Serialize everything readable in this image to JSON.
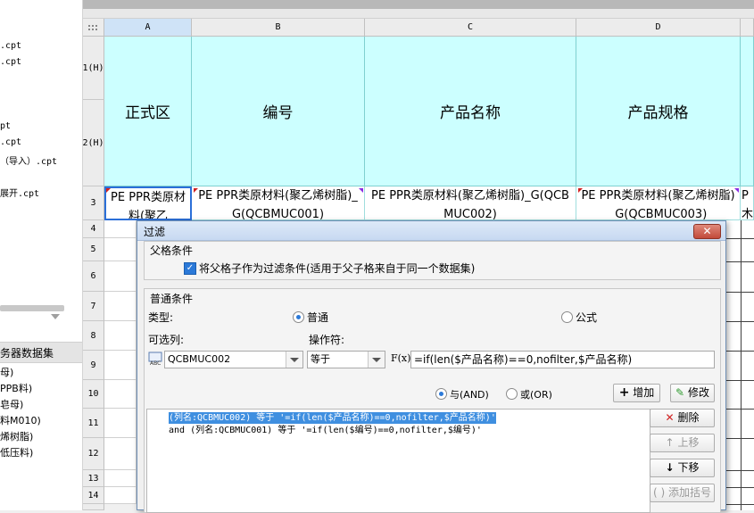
{
  "left_panel": {
    "files": [
      ".cpt",
      ".cpt",
      "pt",
      ".cpt",
      "（导入）.cpt",
      "展开.cpt"
    ],
    "section_title": "务器数据集",
    "datasets": [
      "母)",
      "PPB料)",
      "皂母)",
      "料M010)",
      "烯树脂)",
      "低压料)"
    ]
  },
  "sheet": {
    "columns": [
      "A",
      "B",
      "C",
      "D"
    ],
    "rows": [
      "1(H)",
      "2(H)",
      "3",
      "4",
      "5",
      "6",
      "7",
      "8",
      "9",
      "10",
      "11",
      "12",
      "13",
      "14"
    ],
    "header_cells": [
      "正式区",
      "编号",
      "产品名称",
      "产品规格"
    ],
    "row3_cells": [
      "PE  PPR类原材料(聚乙",
      "PE  PPR类原材料(聚乙烯树脂)_G(QCBMUC001)",
      "PE  PPR类原材料(聚乙烯树脂)_G(QCBMUC002)",
      "PE  PPR类原材料(聚乙烯树脂)_G(QCBMUC003)",
      "P 木"
    ]
  },
  "dialog": {
    "title": "过滤",
    "close_label": "✕",
    "parent_group": {
      "title": "父格条件",
      "checkbox_label": "将父格子作为过滤条件(适用于父子格来自于同一个数据集)",
      "checked": true
    },
    "normal_group": {
      "title": "普通条件",
      "type_label": "类型:",
      "type_options": [
        "普通",
        "公式"
      ],
      "type_selected": "普通",
      "column_label": "可选列:",
      "column_value": "QCBMUC002",
      "operator_label": "操作符:",
      "operator_value": "等于",
      "fx_label": "F(x)",
      "formula_value": "=if(len($产品名称)==0,nofilter,$产品名称)"
    },
    "logic": {
      "and_label": "与(AND)",
      "or_label": "或(OR)",
      "selected": "与(AND)"
    },
    "buttons": {
      "add": "增加",
      "modify": "修改",
      "delete": "删除",
      "up": "上移",
      "down": "下移",
      "add_bracket": "添加括号"
    },
    "conditions": [
      "(列名:QCBMUC002) 等于 '=if(len($产品名称)==0,nofilter,$产品名称)'",
      "and (列名:QCBMUC001) 等于 '=if(len($编号)==0,nofilter,$编号)'"
    ]
  }
}
